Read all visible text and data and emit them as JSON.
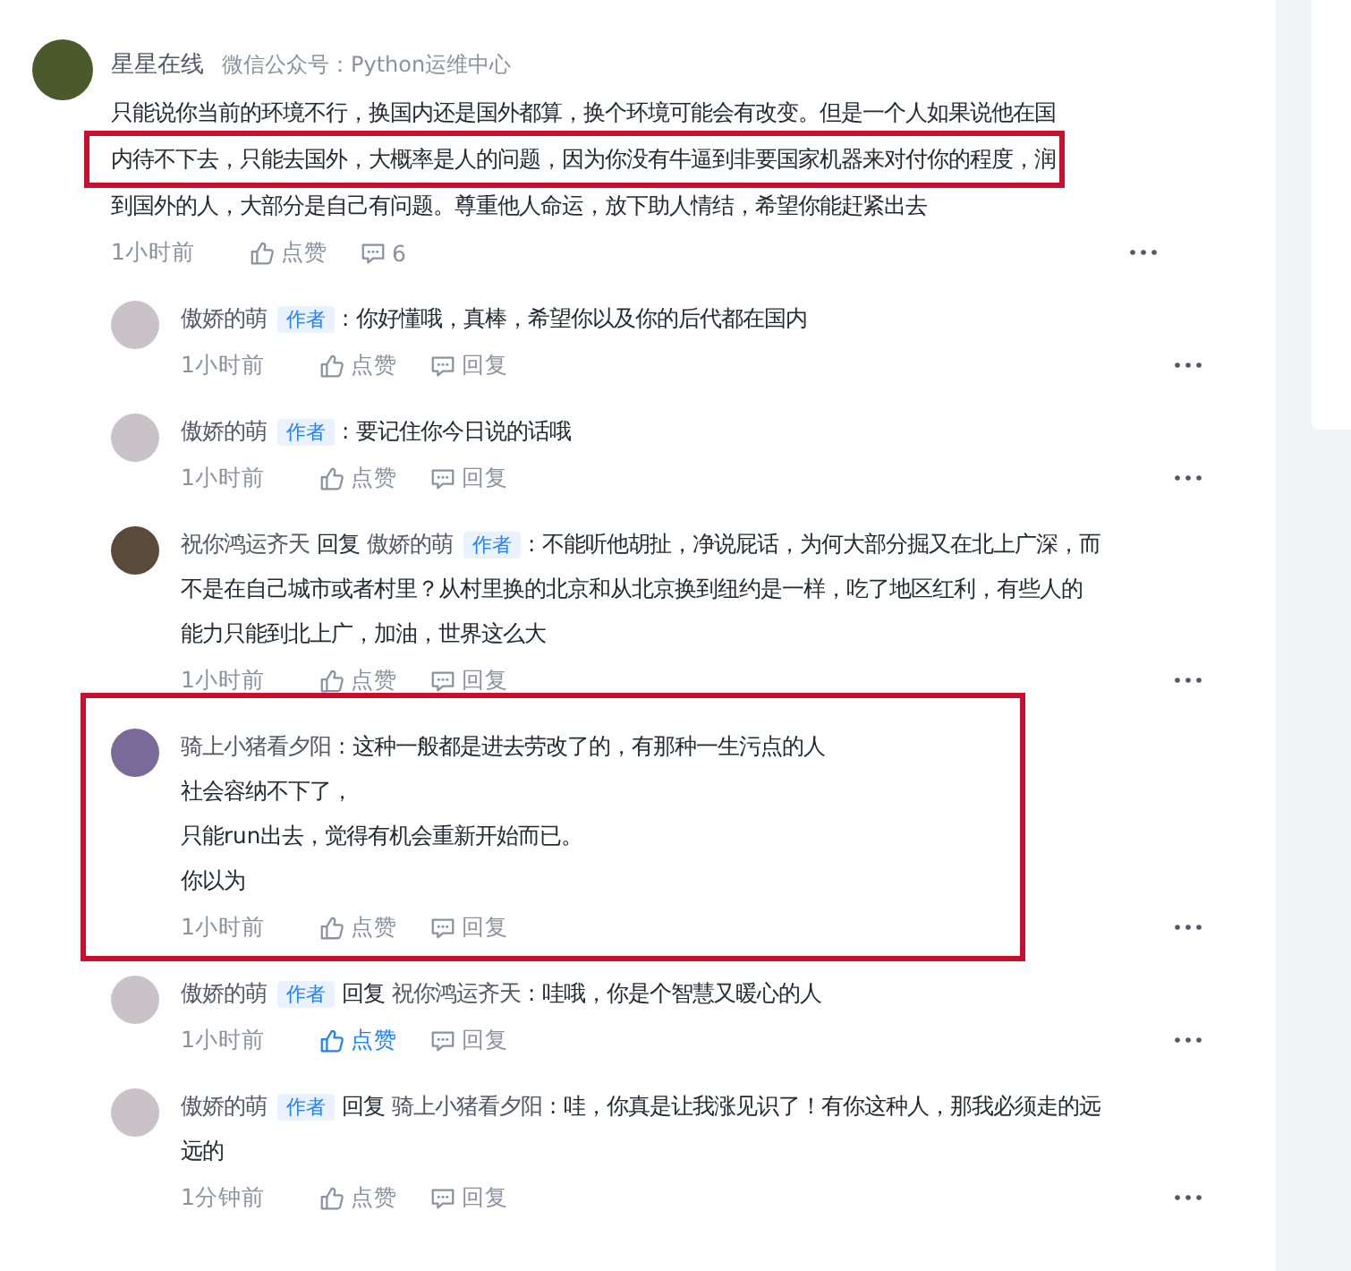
{
  "comment": {
    "author": "星星在线",
    "source": "微信公众号：Python运维中心",
    "color": "#4a5a2a",
    "lines": [
      {
        "text": "只能说你当前的环境不行，换国内还是国外都算，换个环境可能会有改变。但是一个人如果说他在国",
        "highlighted": false
      },
      {
        "text": "内待不下去，只能去国外，大概率是人的问题，因为你没有牛逼到非要国家机器来对付你的程度，润",
        "highlighted": true
      },
      {
        "text": "到国外的人，大部分是自己有问题。尊重他人命运，放下助人情结，希望你能赶紧出去",
        "highlighted": false
      }
    ],
    "time": "1小时前",
    "like_label": "点赞",
    "reply_count": "6"
  },
  "replies": [
    {
      "author": "傲娇的萌",
      "author_badge": "作者",
      "separator": ":",
      "text_lines": [
        "你好懂哦，真棒，希望你以及你的后代都在国内"
      ],
      "time": "1小时前",
      "like_label": "点赞",
      "reply_button": "回复",
      "liked": false,
      "color": "#c9c2c6"
    },
    {
      "author": "傲娇的萌",
      "author_badge": "作者",
      "separator": ":",
      "text_lines": [
        "要记住你今日说的话哦"
      ],
      "time": "1小时前",
      "like_label": "点赞",
      "reply_button": "回复",
      "liked": false,
      "color": "#c9c2c6"
    },
    {
      "author": "祝你鸿运齐天",
      "reply_label": "回复",
      "reply_to": "傲娇的萌",
      "reply_to_badge": "作者",
      "separator": ":",
      "text_lines": [
        "不能听他胡扯，净说屁话，为何大部分掘又在北上广深，而",
        "不是在自己城市或者村里？从村里换的北京和从北京换到纽约是一样，吃了地区红利，有些人的",
        "能力只能到北上广，加油，世界这么大"
      ],
      "time": "1小时前",
      "like_label": "点赞",
      "reply_button": "回复",
      "liked": false,
      "color": "#5a4a3a"
    },
    {
      "author": "骑上小猪看夕阳",
      "separator": ":",
      "text_lines": [
        "这种一般都是进去劳改了的，有那种一生污点的人",
        "社会容纳不下了，",
        "只能run出去，觉得有机会重新开始而已。",
        "你以为"
      ],
      "time": "1小时前",
      "like_label": "点赞",
      "reply_button": "回复",
      "liked": false,
      "highlighted": true,
      "color": "#7a6a9a"
    },
    {
      "author": "傲娇的萌",
      "author_badge": "作者",
      "reply_label": "回复",
      "reply_to": "祝你鸿运齐天",
      "separator": ":",
      "text_lines": [
        "哇哦，你是个智慧又暖心的人"
      ],
      "time": "1小时前",
      "like_label": "点赞",
      "reply_button": "回复",
      "liked": true,
      "color": "#c9c2c6"
    },
    {
      "author": "傲娇的萌",
      "author_badge": "作者",
      "reply_label": "回复",
      "reply_to": "骑上小猪看夕阳",
      "separator": ":",
      "text_lines": [
        "哇，你真是让我涨见识了！有你这种人，那我必须走的远",
        "远的"
      ],
      "time": "1分钟前",
      "like_label": "点赞",
      "reply_button": "回复",
      "liked": false,
      "color": "#c9c2c6"
    }
  ]
}
